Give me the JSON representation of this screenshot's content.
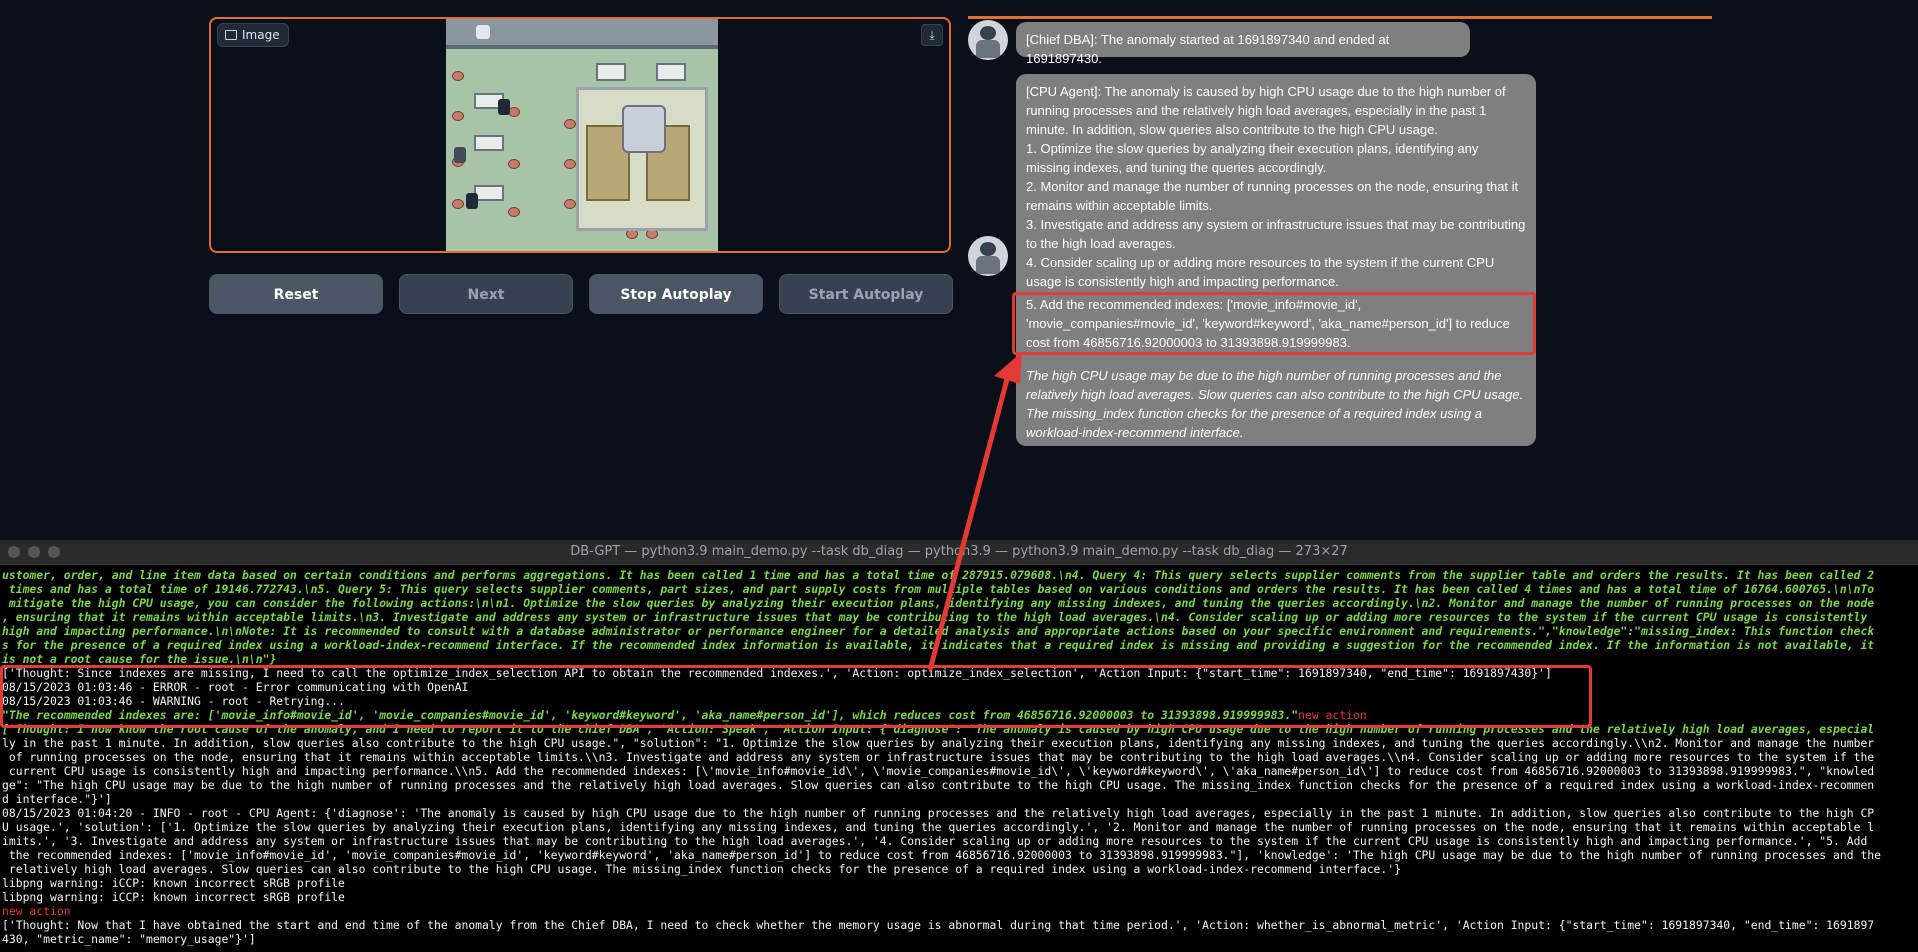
{
  "image_panel": {
    "label": "Image",
    "download_icon": "download-icon"
  },
  "controls": {
    "reset": "Reset",
    "next": "Next",
    "stop_autoplay": "Stop Autoplay",
    "start_autoplay": "Start Autoplay"
  },
  "chat": {
    "chief_dba": "[Chief DBA]: The anomaly started at 1691897340 and ended at 1691897430.",
    "cpu_agent": {
      "intro": "[CPU Agent]: The anomaly is caused by high CPU usage due to the high number of running processes and the relatively high load averages, especially in the past 1 minute. In addition, slow queries also contribute to the high CPU usage.",
      "items": [
        "1. Optimize the slow queries by analyzing their execution plans, identifying any missing indexes, and tuning the queries accordingly.",
        "2. Monitor and manage the number of running processes on the node, ensuring that it remains within acceptable limits.",
        "3. Investigate and address any system or infrastructure issues that may be contributing to the high load averages.",
        "4. Consider scaling up or adding more resources to the system if the current CPU usage is consistently high and impacting performance."
      ],
      "item5": "5. Add the recommended indexes: ['movie_info#movie_id', 'movie_companies#movie_id', 'keyword#keyword', 'aka_name#person_id'] to reduce cost from 46856716.92000003 to 31393898.919999983.",
      "note": "The high CPU usage may be due to the high number of running processes and the relatively high load averages. Slow queries can also contribute to the high CPU usage. The missing_index function checks for the presence of a required index using a workload-index-recommend interface."
    }
  },
  "terminal": {
    "title": "DB-GPT — python3.9 main_demo.py --task db_diag — python3.9 — python3.9 main_demo.py --task db_diag — 273×27",
    "lines": [
      {
        "c": "g",
        "t": "ustomer, order, and line item data based on certain conditions and performs aggregations. It has been called 1 time and has a total time of 287915.079608.\\n4. Query 4: This query selects supplier comments from the supplier table and orders the results. It has been called 2"
      },
      {
        "c": "g",
        "t": " times and has a total time of 19146.772743.\\n5. Query 5: This query selects supplier comments, part sizes, and part supply costs from multiple tables based on various conditions and orders the results. It has been called 4 times and has a total time of 16764.600765.\\n\\nTo"
      },
      {
        "c": "g",
        "t": " mitigate the high CPU usage, you can consider the following actions:\\n\\n1. Optimize the slow queries by analyzing their execution plans, identifying any missing indexes, and tuning the queries accordingly.\\n2. Monitor and manage the number of running processes on the node"
      },
      {
        "c": "g",
        "t": ", ensuring that it remains within acceptable limits.\\n3. Investigate and address any system or infrastructure issues that may be contributing to the high load averages.\\n4. Consider scaling up or adding more resources to the system if the current CPU usage is consistently"
      },
      {
        "c": "g",
        "t": "high and impacting performance.\\n\\nNote: It is recommended to consult with a database administrator or performance engineer for a detailed analysis and appropriate actions based on your specific environment and requirements.\",\"knowledge\":\"missing_index: This function check"
      },
      {
        "c": "g",
        "t": "s for the presence of a required index using a workload-index-recommend interface. If the recommended index information is available, it indicates that a required index is missing and providing a suggestion for the recommended index. If the information is not available, it"
      },
      {
        "c": "g",
        "t": "is not a root cause for the issue.\\n\\n\"}"
      },
      {
        "c": "w",
        "t": "['Thought: Since indexes are missing, I need to call the optimize_index_selection API to obtain the recommended indexes.', 'Action: optimize_index_selection', 'Action Input: {\"start_time\": 1691897340, \"end_time\": 1691897430}']"
      },
      {
        "c": "w",
        "t": "08/15/2023 01:03:46 - ERROR - root - Error communicating with OpenAI"
      },
      {
        "c": "w",
        "t": "08/15/2023 01:03:46 - WARNING - root - Retrying..."
      },
      {
        "c": "g",
        "t": "\"The recommended indexes are: ['movie_info#movie_id', 'movie_companies#movie_id', 'keyword#keyword', 'aka_name#person_id'], which reduces cost from 46856716.92000003 to 31393898.919999983.\"",
        "tail": "new action"
      },
      {
        "c": "g",
        "t": "['Thought: I now know the root cause of the anomaly, and I need to report it to the chief DBA', 'Action: Speak', 'Action Input: {\"diagnose\": \"The anomaly is caused by high CPU usage due to the high number of running processes and the relatively high load averages, especial"
      },
      {
        "c": "w",
        "t": "ly in the past 1 minute. In addition, slow queries also contribute to the high CPU usage.\", \"solution\": \"1. Optimize the slow queries by analyzing their execution plans, identifying any missing indexes, and tuning the queries accordingly.\\\\n2. Monitor and manage the number"
      },
      {
        "c": "w",
        "t": " of running processes on the node, ensuring that it remains within acceptable limits.\\\\n3. Investigate and address any system or infrastructure issues that may be contributing to the high load averages.\\\\n4. Consider scaling up or adding more resources to the system if the"
      },
      {
        "c": "w",
        "t": " current CPU usage is consistently high and impacting performance.\\\\n5. Add the recommended indexes: [\\'movie_info#movie_id\\', \\'movie_companies#movie_id\\', \\'keyword#keyword\\', \\'aka_name#person_id\\'] to reduce cost from 46856716.92000003 to 31393898.919999983.\", \"knowled"
      },
      {
        "c": "w",
        "t": "ge\": \"The high CPU usage may be due to the high number of running processes and the relatively high load averages. Slow queries can also contribute to the high CPU usage. The missing_index function checks for the presence of a required index using a workload-index-recommen"
      },
      {
        "c": "w",
        "t": "d interface.\"}']"
      },
      {
        "c": "w",
        "t": "08/15/2023 01:04:20 - INFO - root - CPU Agent: {'diagnose': 'The anomaly is caused by high CPU usage due to the high number of running processes and the relatively high load averages, especially in the past 1 minute. In addition, slow queries also contribute to the high CP"
      },
      {
        "c": "w",
        "t": "U usage.', 'solution': ['1. Optimize the slow queries by analyzing their execution plans, identifying any missing indexes, and tuning the queries accordingly.', '2. Monitor and manage the number of running processes on the node, ensuring that it remains within acceptable l"
      },
      {
        "c": "w",
        "t": "imits.', '3. Investigate and address any system or infrastructure issues that may be contributing to the high load averages.', '4. Consider scaling up or adding more resources to the system if the current CPU usage is consistently high and impacting performance.', \"5. Add"
      },
      {
        "c": "w",
        "t": " the recommended indexes: ['movie_info#movie_id', 'movie_companies#movie_id', 'keyword#keyword', 'aka_name#person_id'] to reduce cost from 46856716.92000003 to 31393898.919999983.\"], 'knowledge': 'The high CPU usage may be due to the high number of running processes and the"
      },
      {
        "c": "w",
        "t": " relatively high load averages. Slow queries can also contribute to the high CPU usage. The missing_index function checks for the presence of a required index using a workload-index-recommend interface.'}"
      },
      {
        "c": "w",
        "t": "libpng warning: iCCP: known incorrect sRGB profile"
      },
      {
        "c": "w",
        "t": "libpng warning: iCCP: known incorrect sRGB profile"
      },
      {
        "c": "r",
        "t": "new action"
      },
      {
        "c": "w",
        "t": "['Thought: Now that I have obtained the start and end time of the anomaly from the Chief DBA, I need to check whether the memory usage is abnormal during that time period.', 'Action: whether_is_abnormal_metric', 'Action Input: {\"start_time\": 1691897340, \"end_time\": 1691897"
      },
      {
        "c": "w",
        "t": "430, \"metric_name\": \"memory_usage\"}']"
      }
    ]
  },
  "colors": {
    "accent": "#e0702f",
    "highlight": "#e53935",
    "terminal_green": "#7bd64a"
  }
}
